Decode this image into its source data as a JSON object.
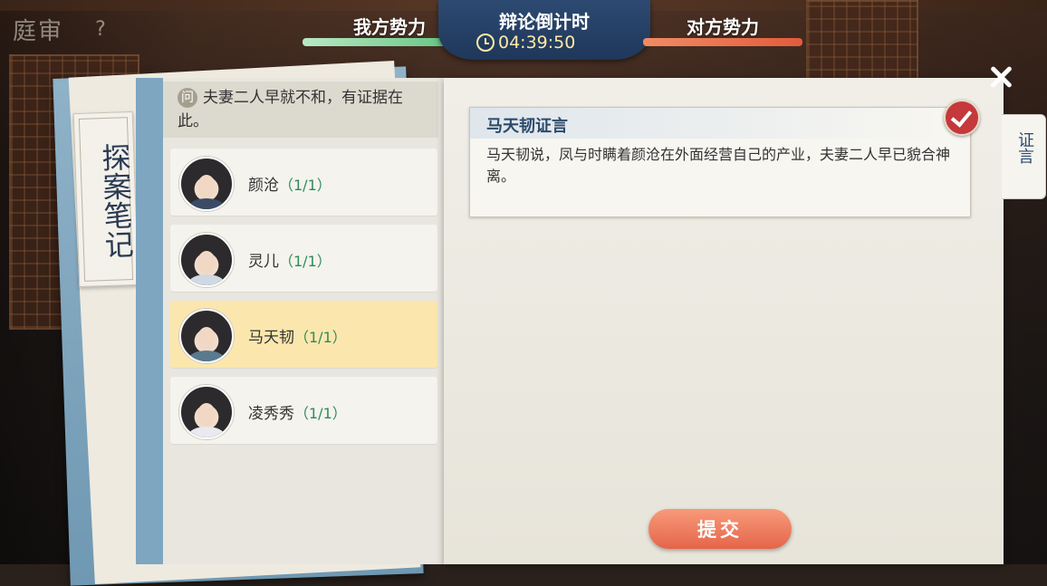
{
  "header": {
    "court_title": "庭审",
    "help_icon": "question-icon",
    "our_side_label": "我方势力",
    "their_side_label": "对方势力",
    "timer_label": "辩论倒计时",
    "timer_value": "04:39:50"
  },
  "notebook": {
    "spine_title": "探案笔记",
    "question_badge": "问",
    "question_text": "夫妻二人早就不和，有证据在此。",
    "characters": [
      {
        "name": "颜沧",
        "count": "（1/1）",
        "selected": false
      },
      {
        "name": "灵儿",
        "count": "（1/1）",
        "selected": false
      },
      {
        "name": "马天韧",
        "count": "（1/1）",
        "selected": true
      },
      {
        "name": "凌秀秀",
        "count": "（1/1）",
        "selected": false
      }
    ]
  },
  "evidence": {
    "title": "马天韧证言",
    "body": "马天韧说，凤与时瞒着颜沧在外面经营自己的产业，夫妻二人早已貌合神离。"
  },
  "side_tab": "证言",
  "submit_label": "提交",
  "colors": {
    "our_bar": "#56c07a",
    "their_bar": "#e25b3c",
    "selected_row": "#fbe7ae",
    "submit": "#e5654a"
  }
}
